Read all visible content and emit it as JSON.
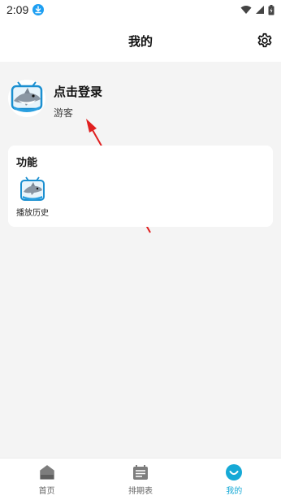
{
  "status_bar": {
    "time": "2:09"
  },
  "header": {
    "title": "我的"
  },
  "profile": {
    "login_label": "点击登录",
    "guest_label": "游客"
  },
  "functions": {
    "title": "功能",
    "items": [
      {
        "label": "播放历史",
        "icon": "shark-tv-icon"
      }
    ]
  },
  "bottom_nav": {
    "items": [
      {
        "label": "首页",
        "icon": "home-icon",
        "active": false
      },
      {
        "label": "排期表",
        "icon": "schedule-icon",
        "active": false
      },
      {
        "label": "我的",
        "icon": "profile-icon",
        "active": true
      }
    ]
  },
  "colors": {
    "accent": "#16a9d6",
    "arrow": "#e02020",
    "download_badge": "#1e9ff2"
  }
}
